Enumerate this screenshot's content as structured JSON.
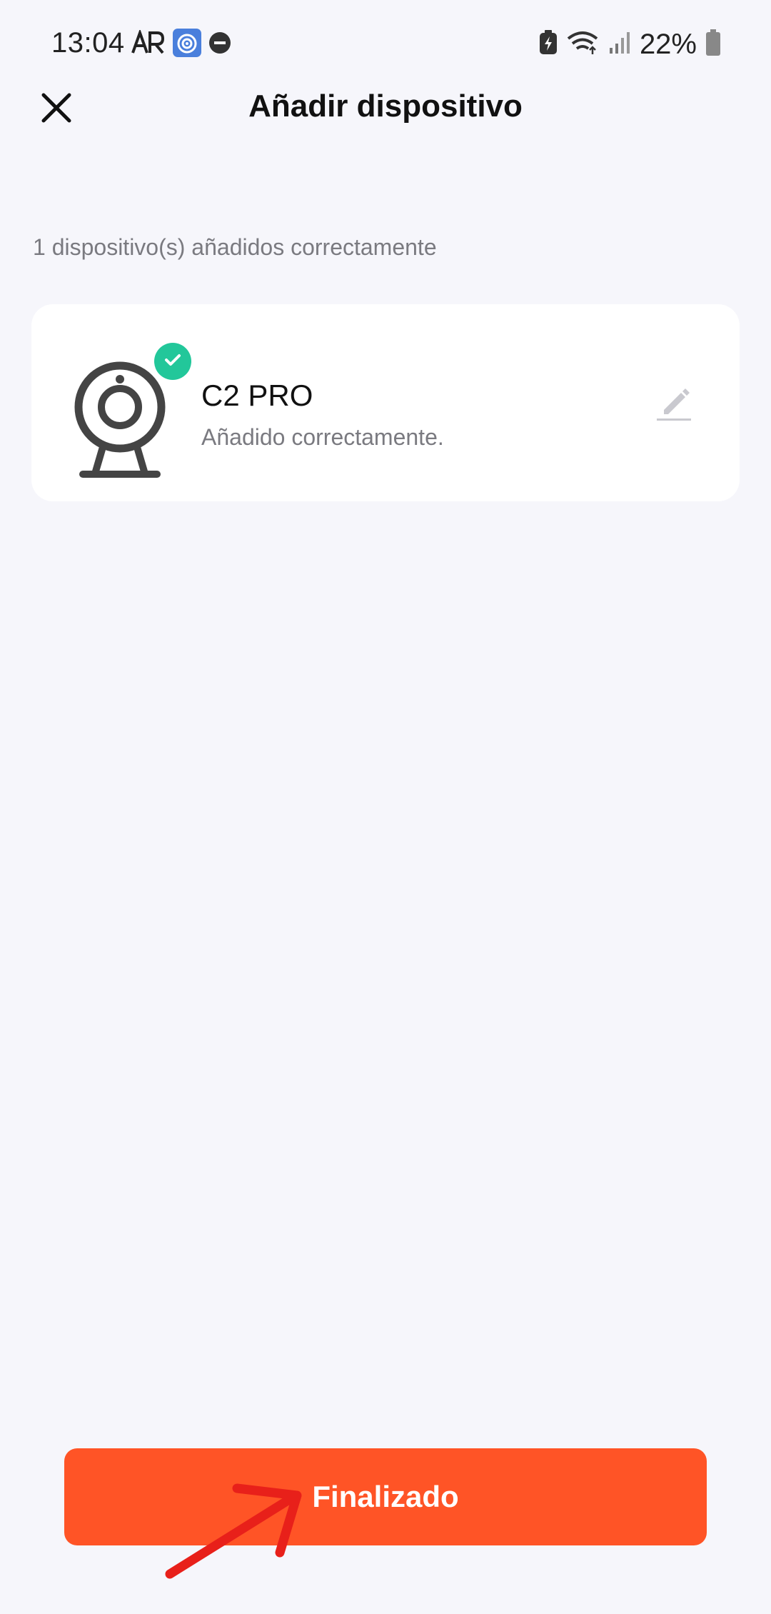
{
  "status_bar": {
    "time": "13:04",
    "battery": "22%",
    "icons_left": [
      "ar-icon",
      "app-target-icon",
      "do-not-disturb-icon"
    ],
    "icons_right": [
      "battery-saver-icon",
      "wifi-icon",
      "signal-icon",
      "battery-icon"
    ]
  },
  "header": {
    "title": "Añadir dispositivo",
    "close_icon": "close-icon"
  },
  "summary": "1 dispositivo(s) añadidos correctamente",
  "device": {
    "name": "C2 PRO",
    "status": "Añadido correctamente.",
    "icon": "camera-icon",
    "badge_icon": "check-icon",
    "edit_icon": "pencil-icon"
  },
  "actions": {
    "done_label": "Finalizado"
  },
  "colors": {
    "background": "#f6f6fb",
    "card": "#ffffff",
    "accent": "#ff5426",
    "success": "#22c79a",
    "annotation": "#e8201a"
  }
}
